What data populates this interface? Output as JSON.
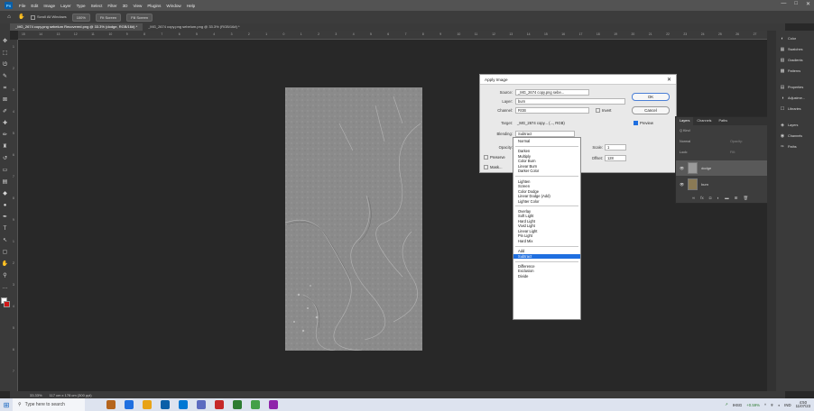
{
  "app": {
    "logo": "Ps",
    "window_controls": [
      "—",
      "□",
      "✕"
    ]
  },
  "menubar": [
    "File",
    "Edit",
    "Image",
    "Layer",
    "Type",
    "Select",
    "Filter",
    "3D",
    "View",
    "Plugins",
    "Window",
    "Help"
  ],
  "options": {
    "scroll_all": "Scroll All Windows",
    "zoom": "100%",
    "fit": "Fit Screen",
    "fill": "Fill Screen"
  },
  "tabs": [
    "_MG_2674 copy.png sebelum Recovered.png @ 33.3% (dodge, RGB/16#) *",
    "_MG_2674 copy.png sebelum.png @ 33.3% (RGB/16#) *"
  ],
  "ruler_h": [
    "15",
    "14",
    "13",
    "12",
    "11",
    "10",
    "9",
    "8",
    "7",
    "6",
    "5",
    "4",
    "3",
    "2",
    "1",
    "0",
    "1",
    "2",
    "3",
    "4",
    "5",
    "6",
    "7",
    "8",
    "9",
    "10",
    "11",
    "12",
    "13",
    "14",
    "15",
    "16",
    "17",
    "18",
    "19",
    "20",
    "21",
    "22",
    "23",
    "24",
    "25",
    "26",
    "27"
  ],
  "ruler_v": [
    "1",
    "2",
    "3",
    "4",
    "5",
    "6",
    "7",
    "8",
    "9",
    "1",
    "2",
    "3",
    "4",
    "5",
    "6",
    "7"
  ],
  "toolbar": [
    {
      "icon": "move-icon",
      "glyph": "✥"
    },
    {
      "icon": "marquee-icon",
      "glyph": "⬚"
    },
    {
      "icon": "lasso-icon",
      "glyph": "ᘎ"
    },
    {
      "icon": "magic-wand-icon",
      "glyph": "✎"
    },
    {
      "icon": "crop-icon",
      "glyph": "⌗"
    },
    {
      "icon": "frame-icon",
      "glyph": "⊠"
    },
    {
      "icon": "eyedropper-icon",
      "glyph": "✐"
    },
    {
      "icon": "healing-icon",
      "glyph": "✚"
    },
    {
      "icon": "brush-icon",
      "glyph": "✏"
    },
    {
      "icon": "stamp-icon",
      "glyph": "♜"
    },
    {
      "icon": "history-brush-icon",
      "glyph": "↺"
    },
    {
      "icon": "eraser-icon",
      "glyph": "▭"
    },
    {
      "icon": "gradient-icon",
      "glyph": "▤"
    },
    {
      "icon": "blur-icon",
      "glyph": "◆"
    },
    {
      "icon": "dodge-icon",
      "glyph": "●"
    },
    {
      "icon": "pen-icon",
      "glyph": "✒"
    },
    {
      "icon": "type-icon",
      "glyph": "T"
    },
    {
      "icon": "path-select-icon",
      "glyph": "↖"
    },
    {
      "icon": "shape-icon",
      "glyph": "▢"
    },
    {
      "icon": "hand-icon",
      "glyph": "✋"
    },
    {
      "icon": "zoom-icon",
      "glyph": "⚲"
    },
    {
      "icon": "more-icon",
      "glyph": "…"
    }
  ],
  "status": {
    "zoom": "33.33%",
    "size": "117 cm x 178 cm (300 ppi)"
  },
  "right_panels": [
    {
      "icon": "color-icon",
      "glyph": "◐",
      "label": "Color"
    },
    {
      "icon": "swatches-icon",
      "glyph": "▦",
      "label": "Swatches"
    },
    {
      "icon": "gradients-icon",
      "glyph": "▧",
      "label": "Gradients"
    },
    {
      "icon": "patterns-icon",
      "glyph": "▩",
      "label": "Patterns"
    },
    {
      "icon": "properties-icon",
      "glyph": "▤",
      "label": "Properties"
    },
    {
      "icon": "adjustments-icon",
      "glyph": "◑",
      "label": "Adjustme..."
    },
    {
      "icon": "libraries-icon",
      "glyph": "☐",
      "label": "Libraries"
    },
    {
      "icon": "layers-icon",
      "glyph": "◈",
      "label": "Layers"
    },
    {
      "icon": "channels-icon",
      "glyph": "◉",
      "label": "Channels"
    },
    {
      "icon": "paths-icon",
      "glyph": "✑",
      "label": "Paths"
    }
  ],
  "dialog": {
    "title": "Apply Image",
    "source_label": "Source:",
    "source_value": "_MG_2674 copy.png sebe...",
    "layer_label": "Layer:",
    "layer_value": "burn",
    "channel_label": "Channel:",
    "channel_value": "RGB",
    "invert_label": "Invert",
    "target_label": "Target:",
    "target_value": "_MG_2674 copy... (..., RGB)",
    "blending_label": "Blending:",
    "blending_value": "Subtract",
    "opacity_label": "Opacity:",
    "preserve_label": "Preserve",
    "mask_label": "Mask...",
    "scale_label": "Scale:",
    "scale_value": "1",
    "offset_label": "Offset:",
    "offset_value": "128",
    "ok": "OK",
    "cancel": "Cancel",
    "preview": "Preview"
  },
  "blend_options": [
    [
      "Normal"
    ],
    [
      "Darken",
      "Multiply",
      "Color Burn",
      "Linear Burn",
      "Darker Color"
    ],
    [
      "Lighten",
      "Screen",
      "Color Dodge",
      "Linear Dodge (Add)",
      "Lighter Color"
    ],
    [
      "Overlay",
      "Soft Light",
      "Hard Light",
      "Vivid Light",
      "Linear Light",
      "Pin Light",
      "Hard Mix"
    ],
    [
      "Add",
      "Subtract"
    ],
    [
      "Difference",
      "Exclusion",
      "Divide"
    ]
  ],
  "blend_selected": "Subtract",
  "layers_panel": {
    "tabs": [
      "Layers",
      "Channels",
      "Paths"
    ],
    "kind": "Q Kind",
    "blend": "Normal",
    "opacity_label": "Opacity:",
    "lock_label": "Lock:",
    "fill_label": "Fill:",
    "layers": [
      {
        "name": "dodge",
        "selected": true
      },
      {
        "name": "burn",
        "selected": false
      }
    ]
  },
  "taskbar": {
    "search": "Type here to search",
    "apps": [
      "edge-icon",
      "ps-icon",
      "explorer-icon",
      "ps2-icon",
      "store-icon",
      "app-icon",
      "app2-icon",
      "chrome-icon",
      "chrome2-icon",
      "app3-icon"
    ],
    "stock": "IHSG",
    "stock_change": "+0.59%",
    "lang": "IND",
    "time": "4:50",
    "date": "11/07/23"
  }
}
